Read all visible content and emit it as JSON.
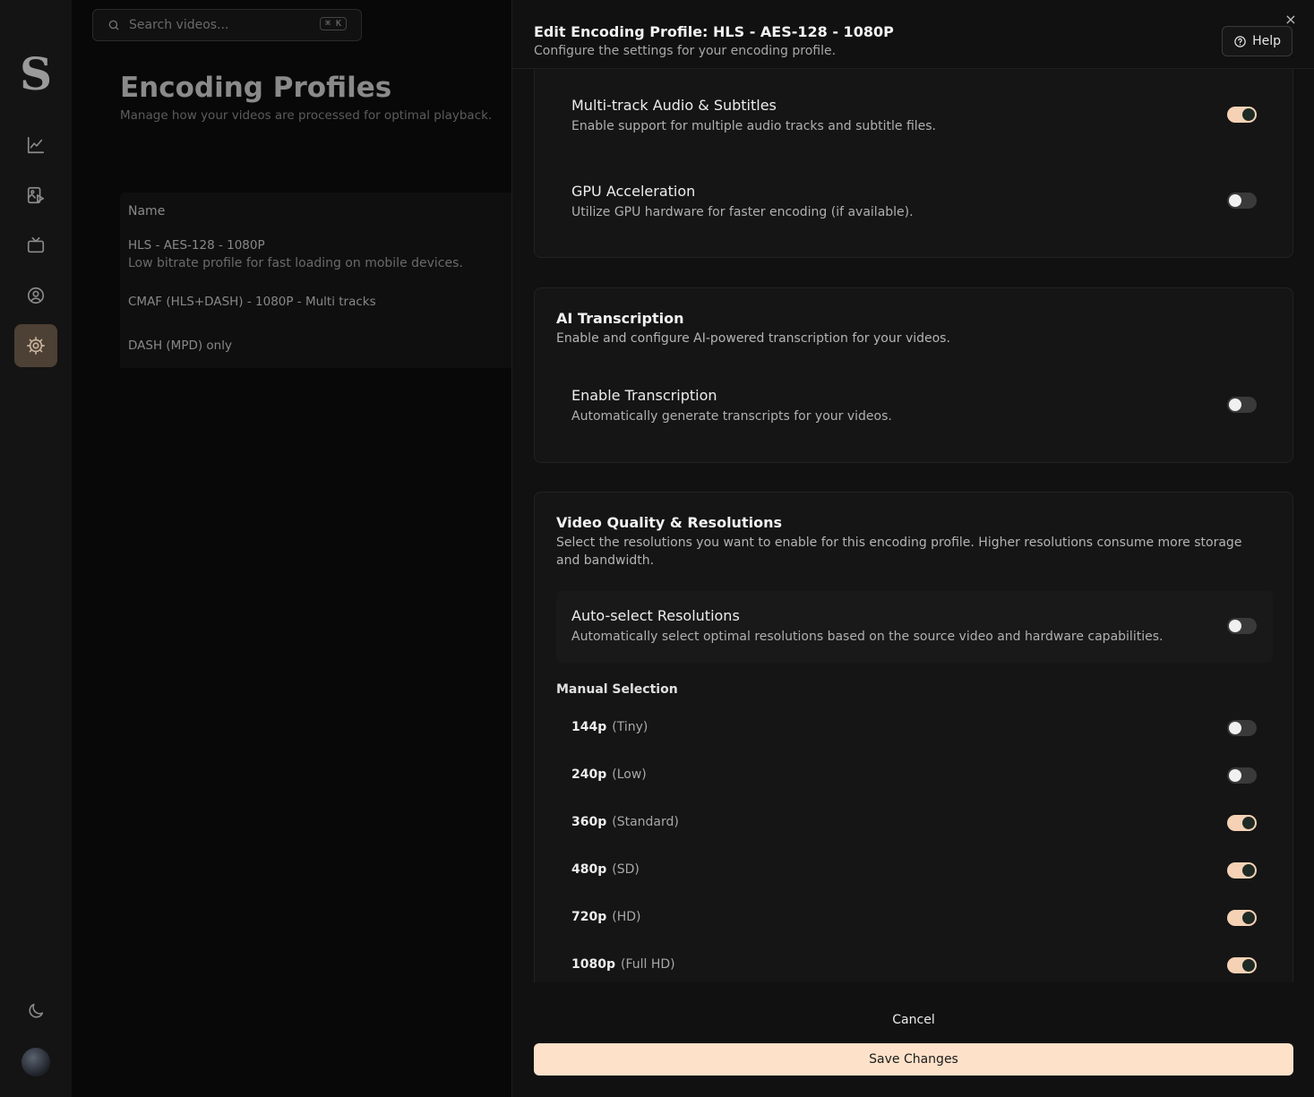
{
  "sidebar": {
    "logo": "S",
    "items": [
      {
        "icon": "analytics-icon"
      },
      {
        "icon": "video-library-icon"
      },
      {
        "icon": "tv-icon"
      },
      {
        "icon": "user-icon"
      },
      {
        "icon": "gear-icon",
        "active": true
      }
    ],
    "theme_icon": "moon-icon"
  },
  "background": {
    "search_placeholder": "Search videos...",
    "shortcut": "⌘ K",
    "title": "Encoding Profiles",
    "subtitle": "Manage how your videos are processed for optimal playback.",
    "table_header": "Name",
    "rows": [
      {
        "name": "HLS - AES-128 - 1080P",
        "desc": "Low bitrate profile for fast loading on mobile devices."
      },
      {
        "name": "CMAF (HLS+DASH) - 1080P - Multi tracks",
        "desc": ""
      },
      {
        "name": "DASH (MPD) only",
        "desc": ""
      }
    ]
  },
  "drawer": {
    "title": "Edit Encoding Profile: HLS - AES-128 - 1080P",
    "subtitle": "Configure the settings for your encoding profile.",
    "help_label": "Help",
    "close_icon": "×",
    "features": [
      {
        "title": "Multi-track Audio & Subtitles",
        "desc": "Enable support for multiple audio tracks and subtitle files.",
        "enabled": true
      },
      {
        "title": "GPU Acceleration",
        "desc": "Utilize GPU hardware for faster encoding (if available).",
        "enabled": false
      }
    ],
    "ai": {
      "title": "AI Transcription",
      "desc": "Enable and configure AI-powered transcription for your videos.",
      "option_title": "Enable Transcription",
      "option_desc": "Automatically generate transcripts for your videos.",
      "enabled": false
    },
    "quality": {
      "title": "Video Quality & Resolutions",
      "desc": "Select the resolutions you want to enable for this encoding profile. Higher resolutions consume more storage and bandwidth.",
      "auto_title": "Auto-select Resolutions",
      "auto_desc": "Automatically select optimal resolutions based on the source video and hardware capabilities.",
      "auto_enabled": false,
      "manual_label": "Manual Selection",
      "resolutions": [
        {
          "res": "144p",
          "tag": "(Tiny)",
          "enabled": false
        },
        {
          "res": "240p",
          "tag": "(Low)",
          "enabled": false
        },
        {
          "res": "360p",
          "tag": "(Standard)",
          "enabled": true
        },
        {
          "res": "480p",
          "tag": "(SD)",
          "enabled": true
        },
        {
          "res": "720p",
          "tag": "(HD)",
          "enabled": true
        },
        {
          "res": "1080p",
          "tag": "(Full HD)",
          "enabled": true
        }
      ]
    },
    "cancel_label": "Cancel",
    "save_label": "Save Changes"
  },
  "colors": {
    "accent": "#fde1c9",
    "toggle_on": "#f5d2b5",
    "toggle_off": "#3a3a3a"
  }
}
